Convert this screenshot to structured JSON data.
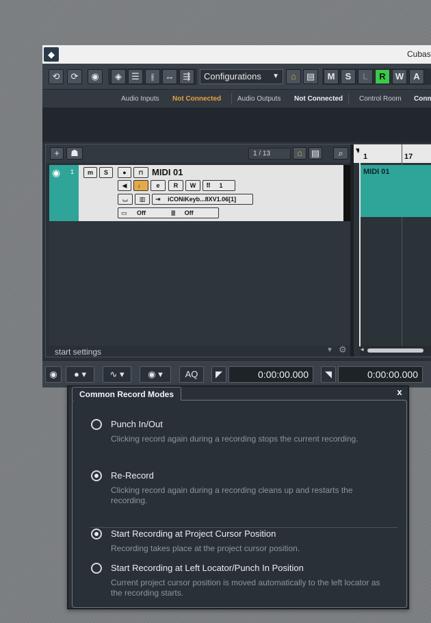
{
  "window": {
    "title": "Cubase",
    "logo": "cubase-logo-icon"
  },
  "toolbar": {
    "configurations_label": "Configurations",
    "m": "M",
    "s": "S",
    "l": "L",
    "r": "R",
    "w": "W",
    "a": "A"
  },
  "status": {
    "audio_inputs_label": "Audio Inputs",
    "audio_inputs_value": "Not Connected",
    "audio_outputs_label": "Audio Outputs",
    "audio_outputs_value": "Not Connected",
    "control_room_label": "Control Room",
    "control_room_value": "Conn"
  },
  "track_list": {
    "counter": "1 / 13",
    "footer": "start settings"
  },
  "track": {
    "number": "1",
    "name": "MIDI 01",
    "mute": "m",
    "solo": "S",
    "read": "R",
    "write": "W",
    "channel": "1",
    "output": "iCONiKeyb...8XV1.06[1]",
    "insert_off": "Off",
    "sends_off": "Off"
  },
  "ruler": {
    "bar1": "1",
    "bar17": "17"
  },
  "event": {
    "name": "MIDI 01"
  },
  "transport": {
    "aq": "AQ",
    "left_time": "0:00:00.000",
    "right_time": "0:00:00.000"
  },
  "dialog": {
    "title": "Common Record Modes",
    "close": "x",
    "options": [
      {
        "label": "Punch In/Out",
        "desc": "Clicking record again during a recording stops the current recording.",
        "selected": false
      },
      {
        "label": "Re-Record",
        "desc": "Clicking record again during a recording cleans up and restarts the recording.",
        "selected": true
      },
      {
        "label": "Start Recording at Project Cursor Position",
        "desc": "Recording takes place at the project cursor position.",
        "selected": true
      },
      {
        "label": "Start Recording at Left Locator/Punch In Position",
        "desc": "Current project cursor position is moved automatically to the left locator as the recording starts.",
        "selected": false
      }
    ]
  },
  "colors": {
    "accent_green": "#3cc84a",
    "track_teal": "#2fa59a",
    "warning_orange": "#e8a23f",
    "monitor_orange": "#e6a94a"
  }
}
